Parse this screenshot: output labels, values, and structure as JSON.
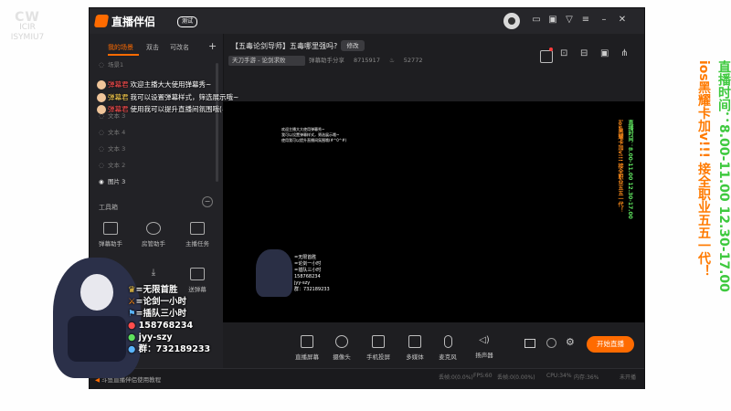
{
  "overlay_logo": {
    "line1": "CW",
    "line2": "ICIR",
    "line3": "ISYMIU7"
  },
  "app": {
    "name": "直播伴侣",
    "version_badge": "测试"
  },
  "tabs": [
    "我的场景",
    "双击",
    "可改名"
  ],
  "scenes": [
    "场景1",
    "文本 3",
    "文本 4",
    "文本 3",
    "文本 2",
    "图片 3"
  ],
  "danmu": [
    {
      "nick": "弹幕君",
      "text": "欢迎主播大大使用弹幕秀~"
    },
    {
      "nick": "弹幕君",
      "text": "我可以设置弹幕样式，筛选展示哦~"
    },
    {
      "nick": "弹幕君",
      "text": "使用我可以提升直播间氛围哦(#^0^#)"
    }
  ],
  "toolbox": {
    "title": "工具箱",
    "tools": [
      "弹幕助手",
      "房管助手",
      "主播任务",
      "",
      "",
      "送弹幕"
    ]
  },
  "footer_tip": "斗鱼直播伴侣使用教程",
  "stream": {
    "title": "【五毒论剑导师】五毒哪里强吗?",
    "edit_label": "修改",
    "category": "天刀手游 - 论剑求败",
    "room_label": "弹幕助手分享",
    "room_id": "8715917",
    "heat": "52772"
  },
  "overlay_card": [
    "=无限首胜",
    "=论剑一小时",
    "=插队三小时",
    "158768234",
    "jyy-szy",
    "群：732189233"
  ],
  "bottom_tools": [
    "直播屏幕",
    "摄像头",
    "手机投屏",
    "多媒体",
    "麦克风",
    "扬声器"
  ],
  "go_live": "开始直播",
  "stats": [
    "丢帧:0(0.0%)",
    "FPS:60",
    "丢帧:0(0.00%)",
    "CPU:34%",
    "内存:36%",
    "未开播"
  ],
  "right_overlay": {
    "col1": "直播时间：8.00-11.00  12.30-17.00",
    "col2": "ios黑耀卡加v!!!  接全职业五五一代！"
  },
  "colors": {
    "accent": "#ff6b00",
    "bg": "#1e1e21",
    "right_green": "#5ee05e",
    "right_orange": "#ff8c1a"
  }
}
